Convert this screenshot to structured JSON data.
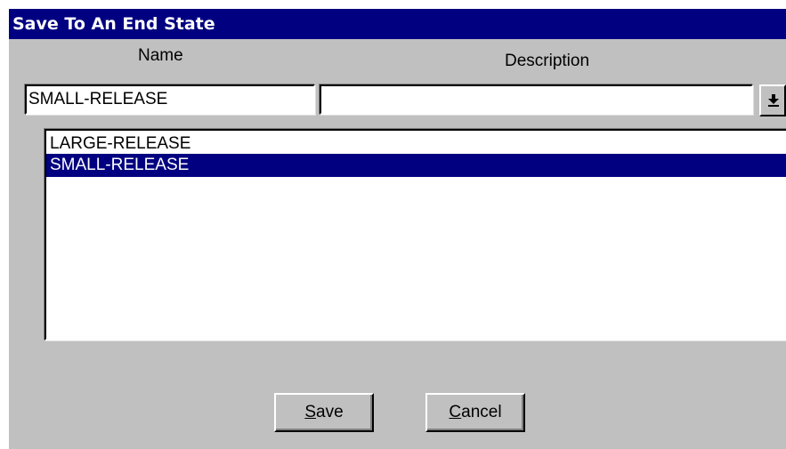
{
  "window": {
    "title": "Save To An End State"
  },
  "columns": {
    "name_label": "Name",
    "description_label": "Description"
  },
  "name_field": {
    "value": "SMALL-RELEASE"
  },
  "description_field": {
    "value": ""
  },
  "dropdown": {
    "icon": "down-arrow-to-bar-icon"
  },
  "list": {
    "items": [
      {
        "label": "LARGE-RELEASE",
        "selected": false
      },
      {
        "label": "SMALL-RELEASE",
        "selected": true
      }
    ]
  },
  "buttons": {
    "save": {
      "mnemonic": "S",
      "rest": "ave"
    },
    "cancel": {
      "mnemonic": "C",
      "rest": "ancel"
    }
  },
  "colors": {
    "title_bar": "#000080",
    "selection": "#000080",
    "face": "#c0c0c0"
  }
}
